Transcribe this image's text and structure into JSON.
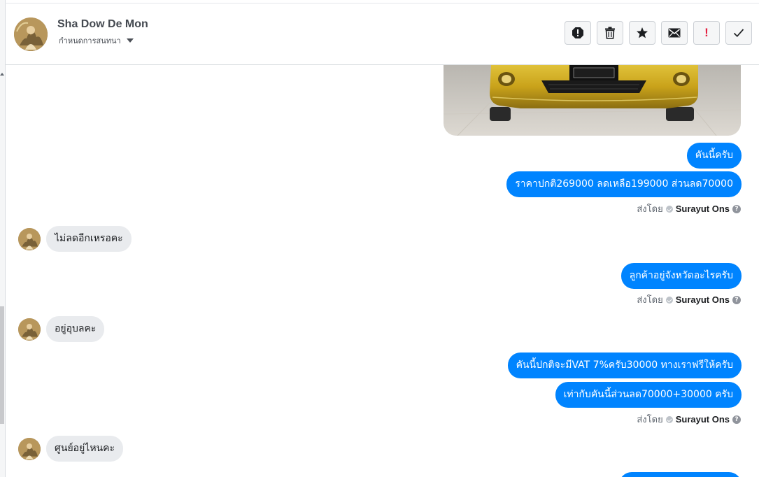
{
  "contact": {
    "name": "Sha Dow De Mon",
    "subtitle": "กำหนดการสนทนา"
  },
  "toolbar": {
    "buttons": [
      {
        "name": "report-spam-button",
        "icon": "octagon-alert-icon"
      },
      {
        "name": "delete-button",
        "icon": "trash-icon"
      },
      {
        "name": "star-button",
        "icon": "star-icon"
      },
      {
        "name": "mark-unread-button",
        "icon": "envelope-icon"
      },
      {
        "name": "follow-up-button",
        "icon": "exclamation-icon",
        "glyph": "!"
      },
      {
        "name": "mark-done-button",
        "icon": "checkmark-icon"
      }
    ]
  },
  "messages": [
    {
      "dir": "out",
      "text": "คันนี้ครับ"
    },
    {
      "dir": "out",
      "text": "ราคาปกติ269000 ลดเหลือ199000 ส่วนลด70000",
      "sent_by_label": "ส่งโดย",
      "sender": "Surayut Ons"
    },
    {
      "dir": "in",
      "text": "ไม่ลดอีกเหรอคะ"
    },
    {
      "dir": "out",
      "text": "ลูกค้าอยู่จังหวัดอะไรครับ",
      "sent_by_label": "ส่งโดย",
      "sender": "Surayut Ons"
    },
    {
      "dir": "in",
      "text": "อยู่อุบลคะ"
    },
    {
      "dir": "out",
      "text": "คันนี้ปกติจะมีVAT 7%ครับ30000 ทางเราฟรีให้ครับ"
    },
    {
      "dir": "out",
      "text": "เท่ากับคันนี้ส่วนลด70000+30000 ครับ",
      "sent_by_label": "ส่งโดย",
      "sender": "Surayut Ons"
    },
    {
      "dir": "in",
      "text": "ศูนย์อยู่ไหนคะ"
    }
  ],
  "help_glyph": "?",
  "colors": {
    "outgoing_bubble": "#0084ff",
    "incoming_bubble": "#e9ebee",
    "alert": "#e41e3f",
    "car_body": "#d8b41f"
  }
}
